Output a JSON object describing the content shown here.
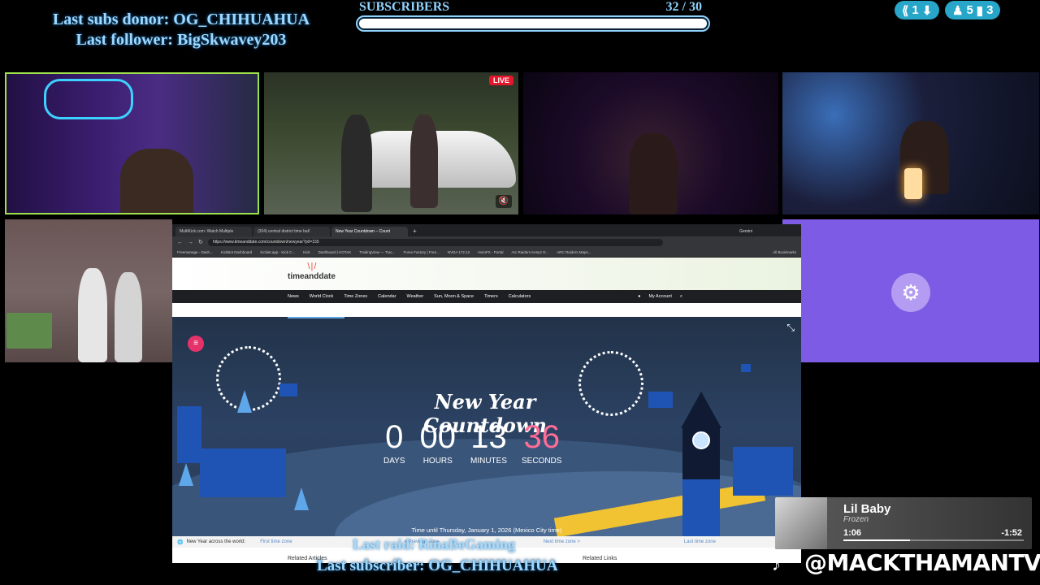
{
  "overlay": {
    "last_subs_donor": "Last subs donor: OG_CHIHUAHUA",
    "last_follower": "Last follower: BigSkwavey203",
    "last_raid": "Last raid: RinaBeGaming",
    "last_subscriber": "Last subscriber: OG_CHIHUAHUA",
    "handle": "@MACKTHAMANTV"
  },
  "subscribers": {
    "label": "SUBSCRIBERS",
    "count": "32  / 30",
    "progress": 1.0
  },
  "badges": [
    {
      "icon": "kick-icon",
      "value": "1"
    },
    {
      "icon": "viewers-icon",
      "value": "5"
    },
    {
      "icon": "bars-icon",
      "value": "3"
    }
  ],
  "live_badge": "LIVE",
  "browser": {
    "tabs": [
      "MultiKick.com: Watch Multiple",
      "(304) central district time ball",
      "New Year Countdown – Count",
      "+"
    ],
    "gemini": "Gemini",
    "url": "https://www.timeanddate.com/countdown/newyear?p0=155",
    "bookmarks": [
      "Freemanage - Dash...",
      "KickBot Dashboard",
      "Kicklet.app - Kick C...",
      "Kick",
      "Dashboard | KOTAK",
      "TradingView — Trac...",
      "Forex Factory | Fore...",
      "NVDA 172.12",
      "HeroFX - Portal",
      "Arc Raiders Kenpz D...",
      "ARC Raiders Maps...",
      "All Bookmarks"
    ],
    "site": {
      "logo": "timeanddate",
      "nav": [
        "News",
        "World Clock",
        "Time Zones",
        "Calendar",
        "Weather",
        "Sun, Moon & Space",
        "Timers",
        "Calculators"
      ],
      "account": "My Account"
    },
    "countdown": {
      "title": "New Year Countdown",
      "units": [
        {
          "value": "0",
          "label": "DAYS"
        },
        {
          "value": "00",
          "label": "HOURS"
        },
        {
          "value": "13",
          "label": "MINUTES"
        },
        {
          "value": "36",
          "label": "SECONDS"
        }
      ],
      "until": "Time until Thursday, January 1, 2026 (Mexico City time)"
    },
    "bottom": {
      "nye_label": "New Year across the world:",
      "first_zone": "First time zone",
      "prev_zone": "< Previous zone",
      "next_zone": "Next time zone >",
      "last_zone": "Last time zone",
      "related_articles": "Related Articles",
      "related_links": "Related Links"
    }
  },
  "now_playing": {
    "artist": "Lil Baby",
    "album": "Frozen",
    "elapsed": "1:06",
    "remaining": "-1:52",
    "progress": 0.37
  }
}
